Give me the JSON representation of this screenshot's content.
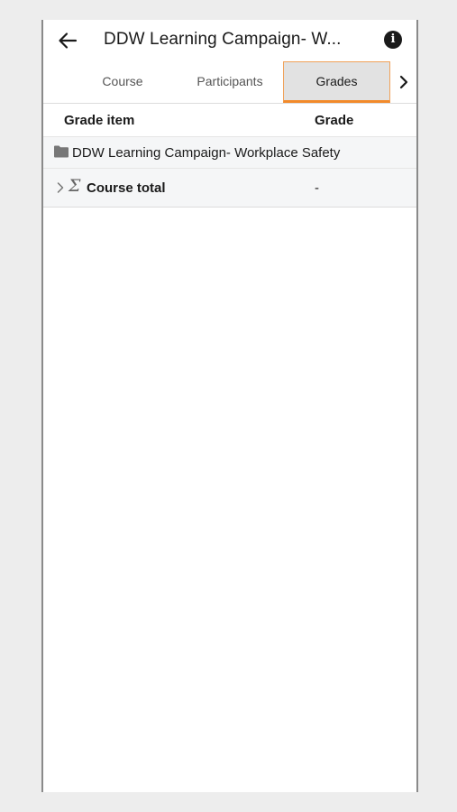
{
  "header": {
    "title": "DDW Learning Campaign- W...",
    "back_icon": "arrow-left-icon",
    "info_icon": "info-icon",
    "info_glyph": "i"
  },
  "tabs": [
    {
      "label": "Course",
      "selected": false
    },
    {
      "label": "Participants",
      "selected": false
    },
    {
      "label": "Grades",
      "selected": true
    }
  ],
  "tabs_next_icon": "chevron-right-icon",
  "grades_table": {
    "headers": {
      "item": "Grade item",
      "grade": "Grade"
    },
    "category": {
      "icon": "folder-icon",
      "label": "DDW Learning Campaign- Workplace Safety"
    },
    "total": {
      "expand_icon": "chevron-right-icon",
      "sigma_icon": "Σ",
      "label": "Course total",
      "grade": "-"
    }
  },
  "colors": {
    "accent": "#f28a2b",
    "selected_tab_bg": "#e2e2e2",
    "row_bg": "#f5f6f7",
    "page_bg": "#ededed"
  }
}
